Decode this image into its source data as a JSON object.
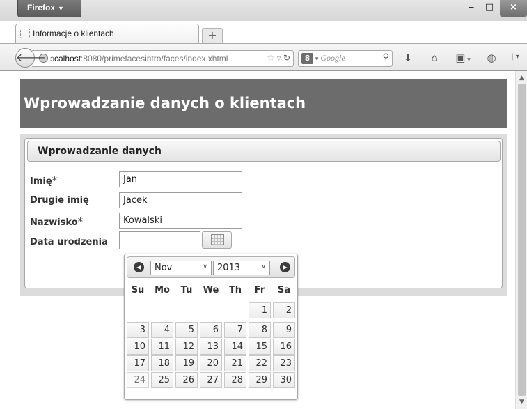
{
  "browser": {
    "menu_label": "Firefox",
    "tab_title": "Informacje o klientach",
    "new_tab_label": "+",
    "url_prefix": "ɔ",
    "url_host": "calhost",
    "url_rest": ":8080/primefacesintro/faces/index.xhtml",
    "search_engine_badge": "8",
    "search_placeholder": "Google",
    "window_controls": {
      "minimize": "‒",
      "maximize": "□",
      "close": "×"
    }
  },
  "page": {
    "header_title": "Wprowadzanie danych o klientach",
    "panel_title": "Wprowadzanie danych",
    "required_marker": "*",
    "fields": {
      "first_name": {
        "label": "Imię",
        "value": "Jan",
        "required": true
      },
      "middle_name": {
        "label": "Drugie imię",
        "value": "Jacek",
        "required": false
      },
      "last_name": {
        "label": "Nazwisko",
        "value": "Kowalski",
        "required": true
      },
      "birth_date": {
        "label": "Data urodzenia",
        "value": ""
      }
    }
  },
  "datepicker": {
    "month": "Nov",
    "year": "2013",
    "weekdays": [
      "Su",
      "Mo",
      "Tu",
      "We",
      "Th",
      "Fr",
      "Sa"
    ],
    "weeks": [
      [
        null,
        null,
        null,
        null,
        null,
        "1",
        "2"
      ],
      [
        "3",
        "4",
        "5",
        "6",
        "7",
        "8",
        "9"
      ],
      [
        "10",
        "11",
        "12",
        "13",
        "14",
        "15",
        "16"
      ],
      [
        "17",
        "18",
        "19",
        "20",
        "21",
        "22",
        "23"
      ],
      [
        "24",
        "25",
        "26",
        "27",
        "28",
        "29",
        "30"
      ]
    ]
  },
  "icons": {
    "back": "back-arrow-icon",
    "home": "home-icon",
    "download": "download-icon",
    "bookmarks": "bookmarks-icon",
    "calendar": "calendar-icon"
  }
}
